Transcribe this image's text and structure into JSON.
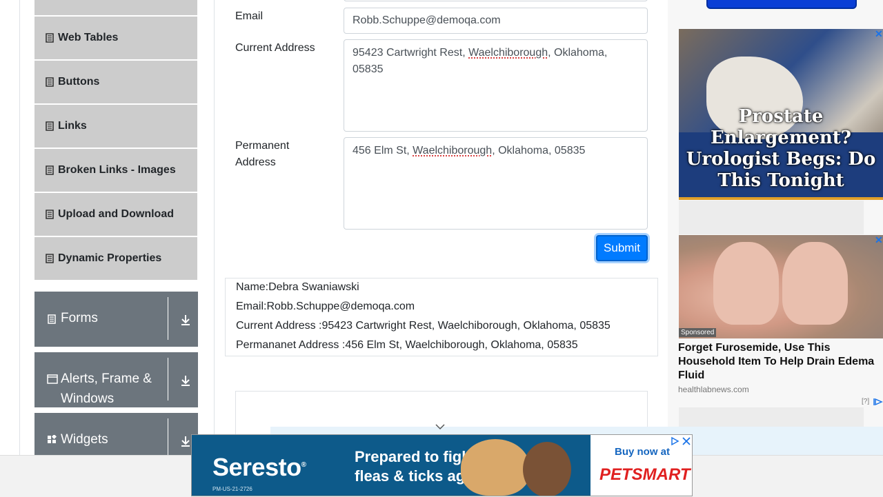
{
  "sidebar": {
    "items": [
      {
        "label": "Web Tables"
      },
      {
        "label": "Buttons"
      },
      {
        "label": "Links"
      },
      {
        "label": "Broken Links - Images"
      },
      {
        "label": "Upload and Download"
      },
      {
        "label": "Dynamic Properties"
      }
    ],
    "groups": [
      {
        "label": "Forms",
        "icon": "form-icon"
      },
      {
        "label": "Alerts, Frame &",
        "label2": "Windows",
        "icon": "window-icon"
      },
      {
        "label": "Widgets",
        "icon": "widgets-icon"
      }
    ]
  },
  "form": {
    "email_label": "Email",
    "email_value": "Robb.Schuppe@demoqa.com",
    "current_label": "Current Address",
    "current_value_a": "95423 Cartwright Rest, ",
    "current_value_b": "Waelchiborough",
    "current_value_c": ", Oklahoma,",
    "current_value_d": "05835",
    "permanent_label_1": "Permanent",
    "permanent_label_2": "Address",
    "permanent_value_a": "456 Elm St, ",
    "permanent_value_b": "Waelchiborough",
    "permanent_value_c": ", Oklahoma, 05835",
    "submit_label": "Submit"
  },
  "output": {
    "name": "Name:Debra Swaniawski",
    "email": "Email:Robb.Schuppe@demoqa.com",
    "current": "Current Address :95423 Cartwright Rest, Waelchiborough, Oklahoma, 05835",
    "permanent": "Permananet Address :456 Elm St, Waelchiborough, Oklahoma, 05835"
  },
  "ads": {
    "ad1_headline": "Prostate Enlargement? Urologist Begs: Do This Tonight",
    "ad2_badge": "Sponsored",
    "ad2_title": "Forget Furosemide, Use This Household Item To Help Drain Edema Fluid",
    "ad2_source": "healthlabnews.com",
    "ad2_info": "[?]",
    "banner_brand": "Seresto",
    "banner_brand_mark": "®",
    "banner_fine": "PM-US-21-2726",
    "banner_tag_1": "Prepared to fight",
    "banner_tag_2": "fleas & ticks again?",
    "banner_buy": "Buy now at",
    "banner_store": "PETSMART"
  },
  "colors": {
    "accent": "#007bff",
    "sidebar_item_bg": "#cccccc",
    "group_header_bg": "#6c757d",
    "banner_bg": "#0d5a8a"
  }
}
